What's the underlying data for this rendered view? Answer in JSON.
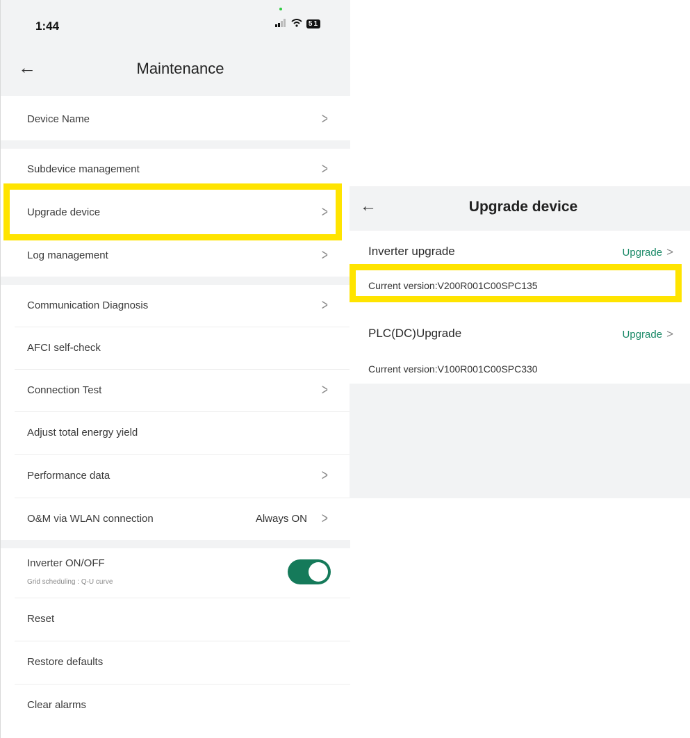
{
  "left": {
    "status": {
      "time": "1:44",
      "battery": "51"
    },
    "title": "Maintenance",
    "items": [
      {
        "label": "Device Name"
      },
      {
        "label": "Subdevice management"
      },
      {
        "label": "Upgrade device"
      },
      {
        "label": "Log management"
      },
      {
        "label": "Communication Diagnosis"
      },
      {
        "label": "AFCI self-check"
      },
      {
        "label": "Connection Test"
      },
      {
        "label": "Adjust total energy yield"
      },
      {
        "label": "Performance data"
      },
      {
        "label": "O&M via WLAN connection",
        "value": "Always ON"
      },
      {
        "label": "Inverter ON/OFF",
        "sub": "Grid scheduling : Q-U curve",
        "toggle_on": true
      },
      {
        "label": "Reset"
      },
      {
        "label": "Restore defaults"
      },
      {
        "label": "Clear alarms"
      }
    ]
  },
  "right": {
    "title": "Upgrade device",
    "sections": [
      {
        "label": "Inverter upgrade",
        "action": "Upgrade",
        "version": "Current version:V200R001C00SPC135"
      },
      {
        "label": "PLC(DC)Upgrade",
        "action": "Upgrade",
        "version": "Current version:V100R001C00SPC330"
      }
    ]
  },
  "colors": {
    "highlight": "#ffe400",
    "accent": "#1b8a68",
    "toggle": "#157a5a"
  }
}
